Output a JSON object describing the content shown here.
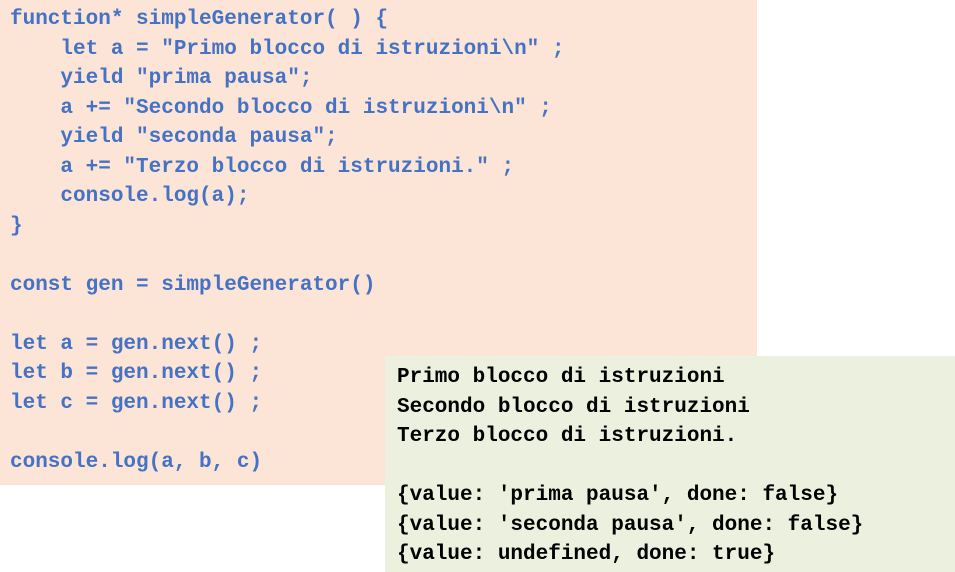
{
  "code_block": {
    "background": "#fce4d6",
    "text_color": "#4472c4",
    "lines": [
      "function* simpleGenerator( ) {",
      "    let a = \"Primo blocco di istruzioni\\n\" ;",
      "    yield \"prima pausa\";",
      "    a += \"Secondo blocco di istruzioni\\n\" ;",
      "    yield \"seconda pausa\";",
      "    a += \"Terzo blocco di istruzioni.\" ;",
      "    console.log(a);",
      "}",
      "",
      "const gen = simpleGenerator()",
      "",
      "let a = gen.next() ;",
      "let b = gen.next() ;",
      "let c = gen.next() ;",
      "",
      "console.log(a, b, c)"
    ]
  },
  "output_block": {
    "background": "#ebf1de",
    "text_color": "#000000",
    "lines": [
      "Primo blocco di istruzioni",
      "Secondo blocco di istruzioni",
      "Terzo blocco di istruzioni.",
      "",
      "{value: 'prima pausa', done: false}",
      "{value: 'seconda pausa', done: false}",
      "{value: undefined, done: true}"
    ]
  }
}
